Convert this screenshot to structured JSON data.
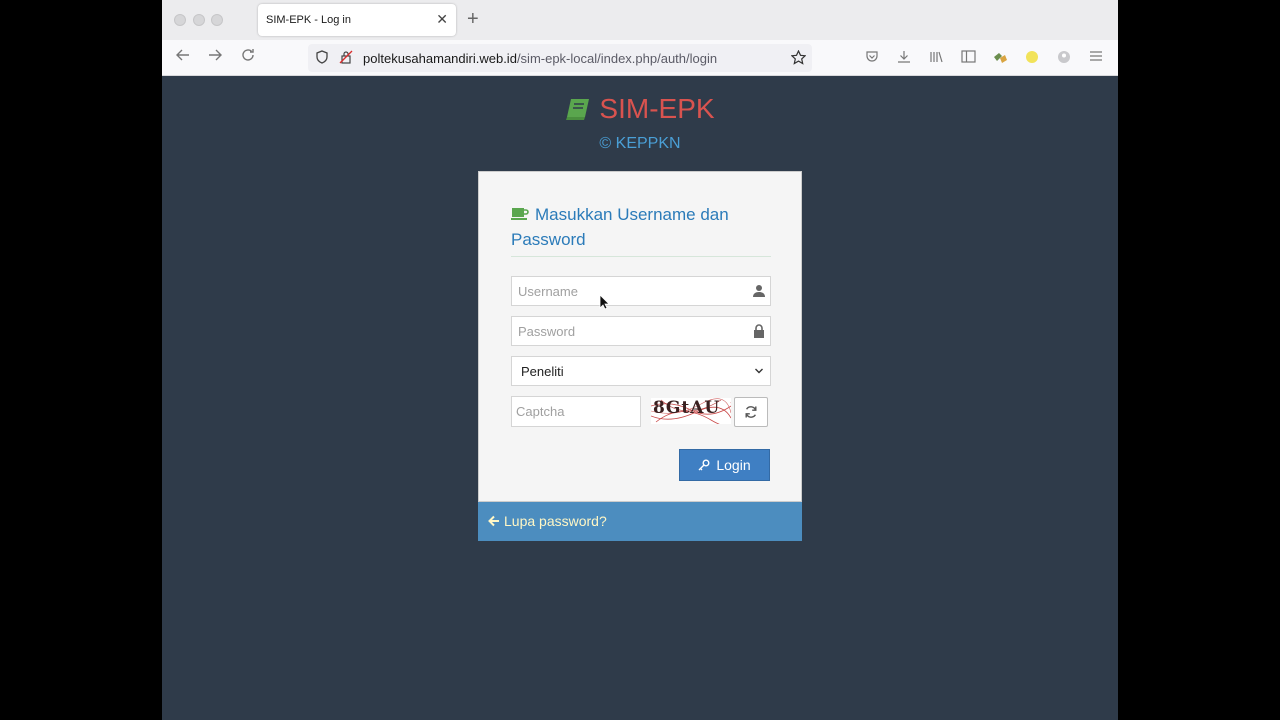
{
  "browser": {
    "tab_title": "SIM-EPK - Log in",
    "close_glyph": "✕",
    "newtab_glyph": "+",
    "url_host": "poltekusahamandiri.web.id",
    "url_path": "/sim-epk-local/index.php/auth/login",
    "icons": [
      "back-icon",
      "forward-icon",
      "reload-icon",
      "shield-icon",
      "permissions-icon",
      "bookmark-star-icon",
      "pocket-icon",
      "download-icon",
      "library-icon",
      "sidebar-icon",
      "extension-icon",
      "extension-yellow-icon",
      "account-icon",
      "menu-icon"
    ]
  },
  "brand": {
    "title": "SIM-EPK",
    "subtitle": "© KEPPKN",
    "title_color": "#d9534f",
    "subtitle_color": "#4a9fd6"
  },
  "login": {
    "heading": "Masukkan Username dan Password",
    "username_placeholder": "Username",
    "password_placeholder": "Password",
    "role_selected": "Peneliti",
    "captcha_placeholder": "Captcha",
    "captcha_text": "8GtAU",
    "login_label": "Login",
    "accent": "#3f7fc3"
  },
  "footer": {
    "forgot_label": "Lupa password?",
    "bar_color": "#4c8dbf"
  }
}
